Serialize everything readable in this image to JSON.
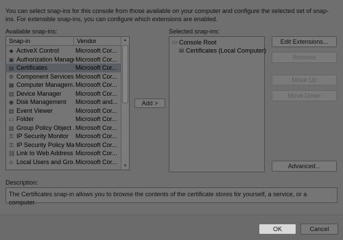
{
  "intro_text": "You can select snap-ins for this console from those available on your computer and configure the selected set of snap-ins. For extensible snap-ins, you can configure which extensions are enabled.",
  "available": {
    "label": "Available snap-ins:",
    "headers": {
      "snapin": "Snap-in",
      "vendor": "Vendor"
    },
    "rows": [
      {
        "name": "ActiveX Control",
        "vendor": "Microsoft Cor...",
        "icon": "activex-icon"
      },
      {
        "name": "Authorization Manager",
        "vendor": "Microsoft Cor...",
        "icon": "authorization-icon"
      },
      {
        "name": "Certificates",
        "vendor": "Microsoft Cor...",
        "icon": "certificates-icon",
        "selected": true
      },
      {
        "name": "Component Services",
        "vendor": "Microsoft Cor...",
        "icon": "component-services-icon"
      },
      {
        "name": "Computer Managem...",
        "vendor": "Microsoft Cor...",
        "icon": "computer-management-icon"
      },
      {
        "name": "Device Manager",
        "vendor": "Microsoft Cor...",
        "icon": "device-manager-icon"
      },
      {
        "name": "Disk Management",
        "vendor": "Microsoft and...",
        "icon": "disk-management-icon"
      },
      {
        "name": "Event Viewer",
        "vendor": "Microsoft Cor...",
        "icon": "event-viewer-icon"
      },
      {
        "name": "Folder",
        "vendor": "Microsoft Cor...",
        "icon": "folder-icon"
      },
      {
        "name": "Group Policy Object ...",
        "vendor": "Microsoft Cor...",
        "icon": "group-policy-icon"
      },
      {
        "name": "IP Security Monitor",
        "vendor": "Microsoft Cor...",
        "icon": "ip-security-monitor-icon"
      },
      {
        "name": "IP Security Policy Ma...",
        "vendor": "Microsoft Cor...",
        "icon": "ip-security-policy-icon"
      },
      {
        "name": "Link to Web Address",
        "vendor": "Microsoft Cor...",
        "icon": "link-icon"
      },
      {
        "name": "Local Users and Gro...",
        "vendor": "Microsoft Cor...",
        "icon": "local-users-icon"
      }
    ]
  },
  "add_button": "Add >",
  "selected": {
    "label": "Selected snap-ins:",
    "root": "Console Root",
    "child": "Certificates (Local Computer)"
  },
  "side_buttons": {
    "edit_extensions": "Edit Extensions...",
    "remove": "Remove",
    "move_up": "Move Up",
    "move_down": "Move Down",
    "advanced": "Advanced..."
  },
  "description": {
    "label": "Description:",
    "text": "The Certificates snap-in allows you to browse the contents of the certificate stores for yourself, a service, or a computer."
  },
  "footer": {
    "ok": "OK",
    "cancel": "Cancel"
  }
}
